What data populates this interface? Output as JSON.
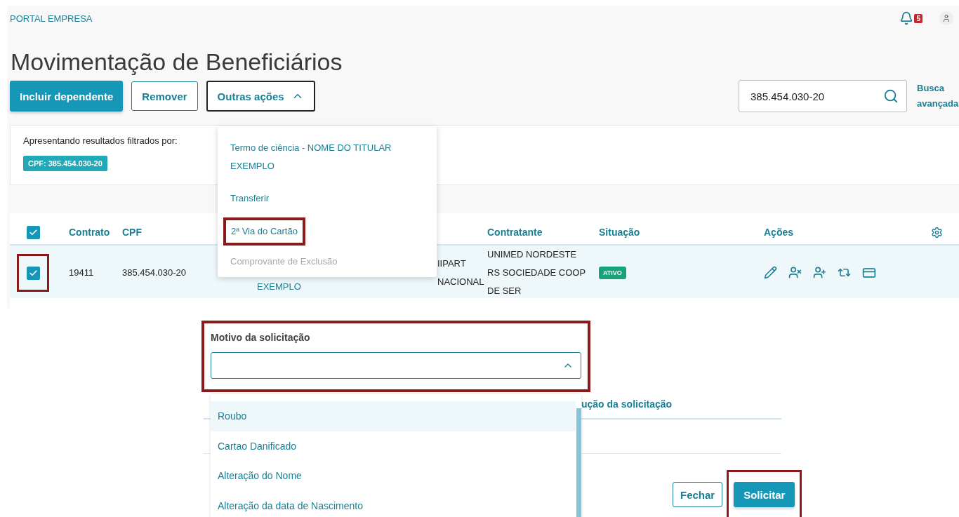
{
  "header": {
    "brand": "PORTAL EMPRESA",
    "notifications": "5"
  },
  "title": "Movimentação de Beneficiários",
  "toolbar": {
    "buttons": [
      {
        "label": "Incluir dependente",
        "kind": "primary"
      },
      {
        "label": "Remover",
        "kind": "secondary"
      },
      {
        "label": "Outras ações",
        "kind": "menu",
        "expanded": true
      }
    ],
    "search": {
      "value": "385.454.030-20"
    },
    "advanced_search": "Busca avançada"
  },
  "filter": {
    "label": "Apresentando resultados filtrados por:",
    "tags": [
      "CPF: 385.454.030-20"
    ]
  },
  "actions_menu": {
    "items": [
      {
        "label": "Termo de ciência - NOME DO TITULAR EXEMPLO",
        "disabled": false,
        "annotated": false
      },
      {
        "label": "Transferir",
        "disabled": false,
        "annotated": false
      },
      {
        "label": "2ª Via do Cartão",
        "disabled": false,
        "annotated": true
      },
      {
        "label": "Comprovante de Exclusão",
        "disabled": true,
        "annotated": false
      }
    ]
  },
  "table": {
    "all_checked": true,
    "columns": [
      "Contrato",
      "CPF",
      "Contratante",
      "Situação",
      "Ações"
    ],
    "rows": [
      {
        "checked": true,
        "annotated": true,
        "contract": "19411",
        "cpf": "385.454.030-20",
        "name": "EXEMPLO",
        "plan": "IIPART NACIONAL",
        "contractor": "UNIMED NORDESTE RS SOCIEDADE COOP DE SER",
        "status": "ATIVO"
      }
    ]
  },
  "request_form": {
    "label": "Motivo da solicitação",
    "annotated": true,
    "expanded": true,
    "options": [
      {
        "label": "Roubo",
        "hovered": true
      },
      {
        "label": "Cartao Danificado",
        "hovered": false
      },
      {
        "label": "Alteração do Nome",
        "hovered": false
      },
      {
        "label": "Alteração da data de Nascimento",
        "hovered": false
      }
    ],
    "section_heading": "ução da solicitação",
    "buttons": [
      {
        "label": "Fechar",
        "kind": "secondary",
        "annotated": false
      },
      {
        "label": "Solicitar",
        "kind": "primary",
        "annotated": true
      }
    ]
  }
}
